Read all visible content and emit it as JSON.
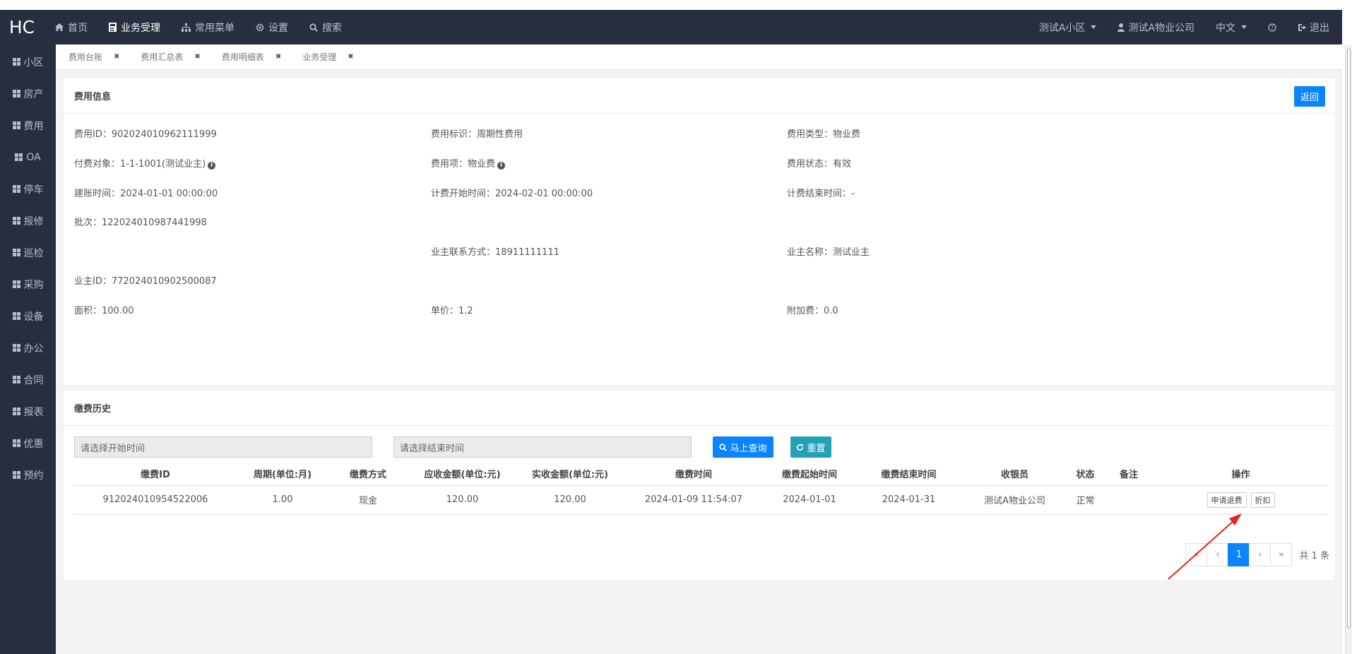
{
  "brand": "HC",
  "topnav": [
    {
      "icon": "home-icon",
      "label": "首页"
    },
    {
      "icon": "calculator-icon",
      "label": "业务受理"
    },
    {
      "icon": "sitemap-icon",
      "label": "常用菜单"
    },
    {
      "icon": "gear-icon",
      "label": "设置"
    },
    {
      "icon": "search-icon",
      "label": "搜索"
    }
  ],
  "topright": {
    "community": "测试A小区",
    "company": "测试A物业公司",
    "language": "中文",
    "help_icon": "help-icon",
    "logout": "退出"
  },
  "sidebar": [
    "小区",
    "房产",
    "费用",
    "OA",
    "停车",
    "报修",
    "巡检",
    "采购",
    "设备",
    "办公",
    "合同",
    "报表",
    "优惠",
    "预约"
  ],
  "tabs": [
    "费用台账",
    "费用汇总表",
    "费用明细表",
    "业务受理"
  ],
  "fee_panel": {
    "title": "费用信息",
    "back_button": "返回",
    "rows": [
      [
        {
          "label": "费用ID：",
          "value": "902024010962111999"
        },
        {
          "label": "费用标识：",
          "value": "周期性费用"
        },
        {
          "label": "费用类型：",
          "value": "物业费"
        }
      ],
      [
        {
          "label": "付费对象：",
          "value": "1-1-1001(测试业主)"
        },
        {
          "label": "费用项：",
          "value": "物业费"
        },
        {
          "label": "费用状态：",
          "value": "有效"
        }
      ],
      [
        {
          "label": "建账时间：",
          "value": "2024-01-01 00:00:00"
        },
        {
          "label": "计费开始时间：",
          "value": "2024-02-01 00:00:00"
        },
        {
          "label": "计费结束时间：",
          "value": "-"
        }
      ],
      [
        {
          "label": "批次：",
          "value": "122024010987441998"
        },
        null,
        null
      ],
      [
        null,
        {
          "label": "业主联系方式：",
          "value": "18911111111"
        },
        {
          "label": "业主名称：",
          "value": "测试业主"
        }
      ],
      [
        {
          "label": "业主ID：",
          "value": "772024010902500087"
        },
        null,
        null
      ],
      [
        {
          "label": "面积：",
          "value": "100.00"
        },
        {
          "label": "单价：",
          "value": "1.2"
        },
        {
          "label": "附加费：",
          "value": "0.0"
        }
      ]
    ]
  },
  "history_panel": {
    "title": "缴费历史",
    "start_placeholder": "请选择开始时间",
    "end_placeholder": "请选择结束时间",
    "query_button": "马上查询",
    "reset_button": "重置",
    "columns": [
      "缴费ID",
      "周期(单位:月)",
      "缴费方式",
      "应收金额(单位:元)",
      "实收金额(单位:元)",
      "缴费时间",
      "缴费起始时间",
      "缴费结束时间",
      "收银员",
      "状态",
      "备注",
      "操作"
    ],
    "rows": [
      [
        "912024010954522006",
        "1.00",
        "现金",
        "120.00",
        "120.00",
        "2024-01-09 11:54:07",
        "2024-01-01",
        "2024-01-31",
        "测试A物业公司",
        "正常",
        ""
      ]
    ],
    "row_actions": [
      "申请退费",
      "折扣"
    ],
    "pager": {
      "first": "«",
      "prev": "‹",
      "current": "1",
      "next": "›",
      "last": "»",
      "total": "共 1 条"
    }
  },
  "colors": {
    "topbar": "#272e40",
    "primary": "#0a84ff",
    "teal": "#23a2b7",
    "annotation": "#e8231f"
  }
}
